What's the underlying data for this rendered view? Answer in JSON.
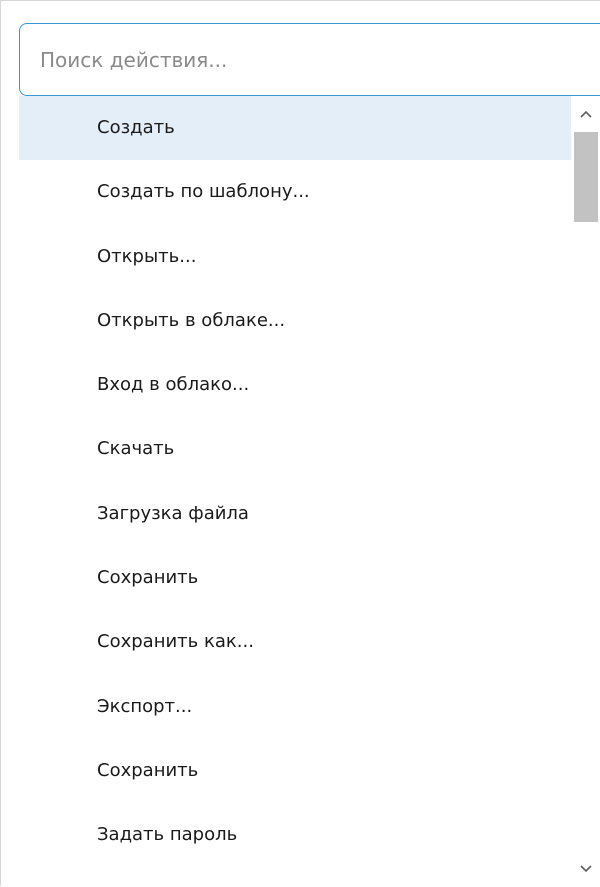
{
  "search": {
    "placeholder": "Поиск действия..."
  },
  "actions": [
    {
      "label": "Создать",
      "selected": true
    },
    {
      "label": "Создать по шаблону...",
      "selected": false
    },
    {
      "label": "Открыть...",
      "selected": false
    },
    {
      "label": "Открыть в облаке...",
      "selected": false
    },
    {
      "label": "Вход в облако...",
      "selected": false
    },
    {
      "label": "Скачать",
      "selected": false
    },
    {
      "label": "Загрузка файла",
      "selected": false
    },
    {
      "label": "Сохранить",
      "selected": false
    },
    {
      "label": "Сохранить как...",
      "selected": false
    },
    {
      "label": "Экспорт...",
      "selected": false
    },
    {
      "label": "Сохранить",
      "selected": false
    },
    {
      "label": "Задать пароль",
      "selected": false
    }
  ],
  "scrollbar": {
    "up_icon": "chevron-up-icon",
    "down_icon": "chevron-down-icon"
  },
  "colors": {
    "accent_border": "#3c96d6",
    "selected_row": "#e3eef9",
    "scroll_thumb": "#c2c2c2"
  }
}
